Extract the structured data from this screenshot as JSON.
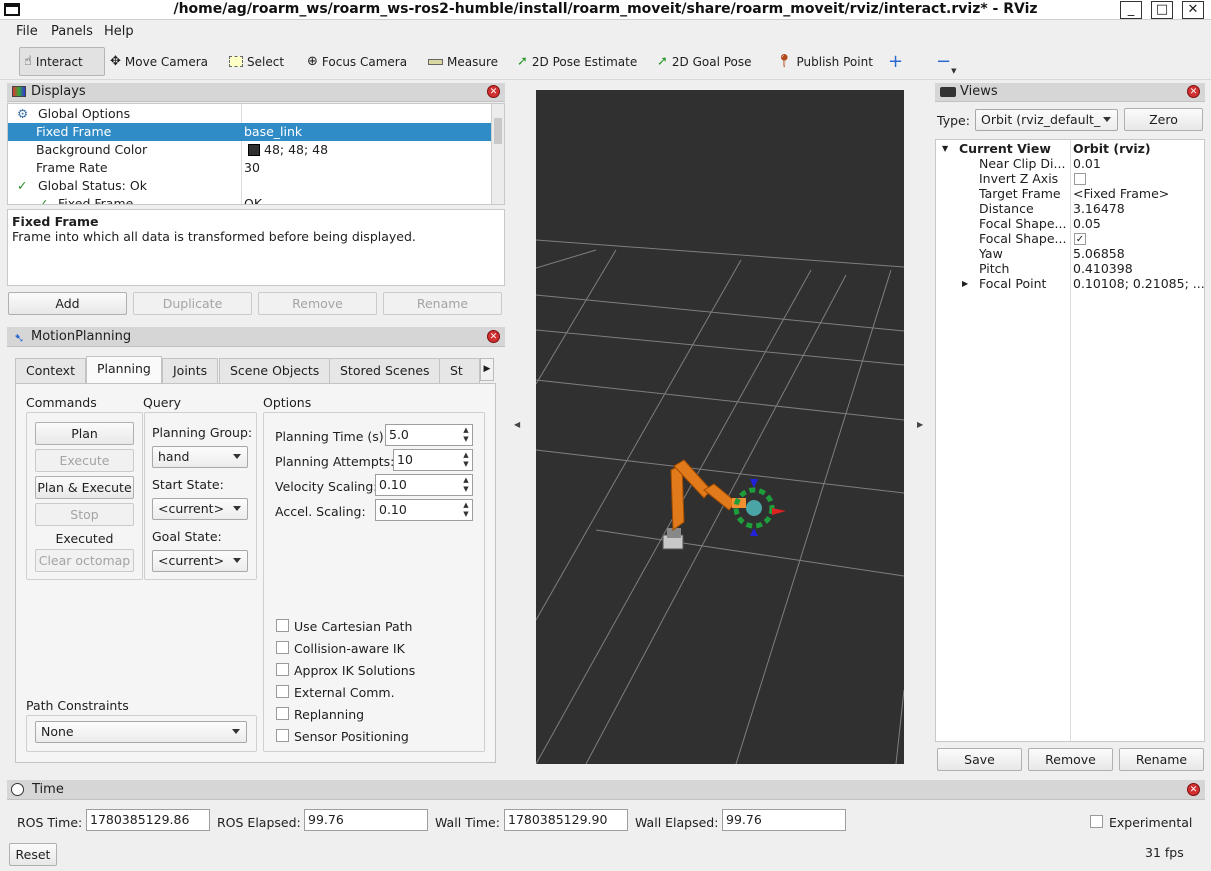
{
  "window": {
    "title": "/home/ag/roarm_ws/roarm_ws-ros2-humble/install/roarm_moveit/share/roarm_moveit/rviz/interact.rviz* - RViz",
    "minimize": "_",
    "maximize": "□",
    "close": "✕"
  },
  "menu": [
    "File",
    "Panels",
    "Help"
  ],
  "toolbar": {
    "tools": [
      {
        "label": "Interact",
        "icon": "hand-icon"
      },
      {
        "label": "Move Camera",
        "icon": "move-camera-icon"
      },
      {
        "label": "Select",
        "icon": "select-icon"
      },
      {
        "label": "Focus Camera",
        "icon": "focus-camera-icon"
      },
      {
        "label": "Measure",
        "icon": "ruler-icon"
      },
      {
        "label": "2D Pose Estimate",
        "icon": "green-arrow-icon"
      },
      {
        "label": "2D Goal Pose",
        "icon": "green-arrow-icon"
      },
      {
        "label": "Publish Point",
        "icon": "map-pin-icon"
      }
    ],
    "add_icon": "plus-icon",
    "remove_icon": "minus-icon",
    "accent": "#2a8a2a"
  },
  "displays": {
    "title": "Displays",
    "rows": [
      {
        "name": "Global Options",
        "value": ""
      },
      {
        "name": "Fixed Frame",
        "value": "base_link"
      },
      {
        "name": "Background Color",
        "value": "48; 48; 48"
      },
      {
        "name": "Frame Rate",
        "value": "30"
      },
      {
        "name": "Global Status: Ok",
        "value": ""
      },
      {
        "name": "Fixed Frame",
        "value": "OK"
      }
    ],
    "selection_color": "#308cc6",
    "help_title": "Fixed Frame",
    "help_text": "Frame into which all data is transformed before being displayed.",
    "buttons": [
      "Add",
      "Duplicate",
      "Remove",
      "Rename"
    ]
  },
  "motion": {
    "title": "MotionPlanning",
    "tabs": [
      "Context",
      "Planning",
      "Joints",
      "Scene Objects",
      "Stored Scenes",
      "St"
    ],
    "commands_label": "Commands",
    "query_label": "Query",
    "options_label": "Options",
    "plan": "Plan",
    "execute": "Execute",
    "plan_execute": "Plan & Execute",
    "stop": "Stop",
    "status": "Executed",
    "clear_octomap": "Clear octomap",
    "planning_group_label": "Planning Group:",
    "planning_group": "hand",
    "start_state_label": "Start State:",
    "start_state": "<current>",
    "goal_state_label": "Goal State:",
    "goal_state": "<current>",
    "options": [
      {
        "label": "Planning Time (s):",
        "value": "5.0"
      },
      {
        "label": "Planning Attempts:",
        "value": "10"
      },
      {
        "label": "Velocity Scaling:",
        "value": "0.10"
      },
      {
        "label": "Accel. Scaling:",
        "value": "0.10"
      }
    ],
    "checkboxes": [
      "Use Cartesian Path",
      "Collision-aware IK",
      "Approx IK Solutions",
      "External Comm.",
      "Replanning",
      "Sensor Positioning"
    ],
    "path_constraints_label": "Path Constraints",
    "path_constraints": "None"
  },
  "views": {
    "title": "Views",
    "type_label": "Type:",
    "type_value": "Orbit (rviz_default_",
    "zero": "Zero",
    "header_name": "Current View",
    "header_value": "Orbit (rviz)",
    "rows": [
      {
        "name": "Near Clip Di...",
        "value": "0.01"
      },
      {
        "name": "Invert Z Axis",
        "value": ""
      },
      {
        "name": "Target Frame",
        "value": "<Fixed Frame>"
      },
      {
        "name": "Distance",
        "value": "3.16478"
      },
      {
        "name": "Focal Shape...",
        "value": "0.05"
      },
      {
        "name": "Focal Shape...",
        "value": ""
      },
      {
        "name": "Yaw",
        "value": "5.06858"
      },
      {
        "name": "Pitch",
        "value": "0.410398"
      },
      {
        "name": "Focal Point",
        "value": "0.10108; 0.21085; ..."
      }
    ],
    "buttons": [
      "Save",
      "Remove",
      "Rename"
    ]
  },
  "time": {
    "title": "Time",
    "ros_time_label": "ROS Time:",
    "ros_time": "1780385129.86",
    "ros_elapsed_label": "ROS Elapsed:",
    "ros_elapsed": "99.76",
    "wall_time_label": "Wall Time:",
    "wall_time": "1780385129.90",
    "wall_elapsed_label": "Wall Elapsed:",
    "wall_elapsed": "99.76",
    "experimental": "Experimental",
    "reset": "Reset",
    "fps": "31 fps"
  },
  "viewport": {
    "background": "#303030",
    "robot_color": "#e07a1a"
  }
}
